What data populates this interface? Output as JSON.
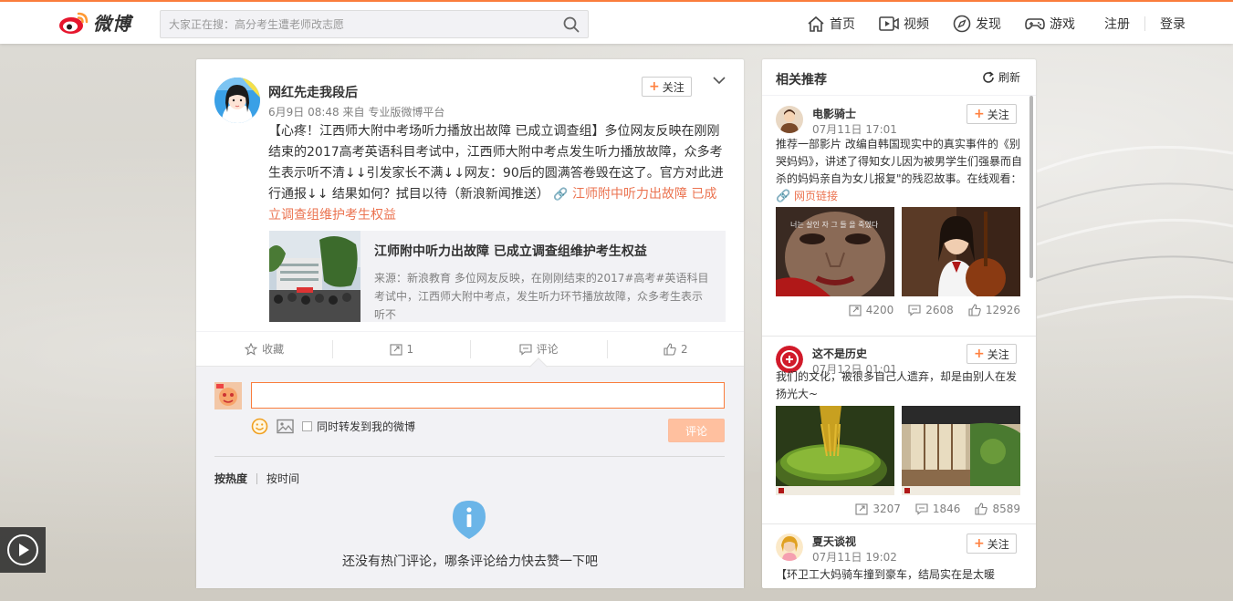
{
  "header": {
    "logo_text": "微博",
    "search_placeholder": "大家正在搜：高分考生遭老师改志愿",
    "nav": [
      {
        "label": "首页",
        "icon": "home-icon"
      },
      {
        "label": "视频",
        "icon": "video-icon"
      },
      {
        "label": "发现",
        "icon": "discover-icon"
      },
      {
        "label": "游戏",
        "icon": "game-icon"
      }
    ],
    "register": "注册",
    "login": "登录"
  },
  "post": {
    "author": "网红先走我段后",
    "date": "6月9日 08:48",
    "source_prefix": "来自",
    "source": "专业版微博平台",
    "follow_label": "关注",
    "text": "【心疼！江西师大附中考场听力播放出故障 已成立调查组】多位网友反映在刚刚结束的2017高考英语科目考试中，江西师大附中考点发生听力播放故障，众多考生表示听不清↓↓引发家长不满↓↓网友：90后的圆满答卷毁在这了。官方对此进行通报↓↓ 结果如何？拭目以待（新浪新闻推送）",
    "link_text": "江师附中听力出故障 已成立调查组维护考生权益",
    "link_icon": "link-icon",
    "embed": {
      "title": "江师附中听力出故障 已成立调查组维护考生权益",
      "desc": "来源：新浪教育 多位网友反映，在刚刚结束的2017#高考#英语科目考试中，江西师大附中考点，发生听力环节播放故障，众多考生表示听不"
    },
    "actions": {
      "favorite": "收藏",
      "repost": "1",
      "comment": "评论",
      "like": "2"
    }
  },
  "comments": {
    "input_value": "",
    "also_repost": "同时转发到我的微博",
    "submit": "评论",
    "sort_hot": "按热度",
    "sort_time": "按时间",
    "empty": "还没有热门评论，哪条评论给力快去赞一下吧"
  },
  "sidebar": {
    "title": "相关推荐",
    "refresh": "刷新",
    "follow_label": "关注",
    "items": [
      {
        "name": "电影骑士",
        "time": "07月11日 17:01",
        "text": "推荐一部影片 改编自韩国现实中的真实事件的《别哭妈妈》，讲述了得知女儿因为被男学生们强暴而自杀的妈妈亲自为女儿报复\"的残忍故事。在线观看：",
        "link": "网页链接",
        "img1_caption": "너는 살인 자 그 들 을 죽였다",
        "reposts": "4200",
        "comments": "2608",
        "likes": "12926"
      },
      {
        "name": "这不是历史",
        "time": "07月12日 01:01",
        "text": "我们的文化，被很多自己人遗弃，却是由别人在发扬光大~",
        "reposts": "3207",
        "comments": "1846",
        "likes": "8589"
      },
      {
        "name": "夏天谈视",
        "time": "07月11日 19:02",
        "text": "【环卫工大妈骑车撞到豪车，结局实在是太暖"
      }
    ]
  },
  "colors": {
    "accent": "#fa7d3c",
    "link": "#eb7350",
    "submit_disabled": "#ffc09f"
  }
}
